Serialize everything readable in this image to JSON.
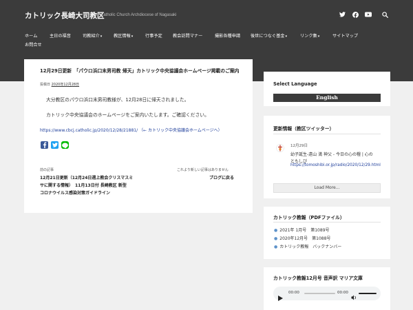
{
  "header": {
    "site_title": "カトリック長崎大司教区",
    "site_subtitle": "Catholic Church Archdiocese of Nagasaki",
    "social": [
      "twitter-icon",
      "facebook-icon",
      "youtube-icon",
      "search-icon"
    ]
  },
  "nav": [
    {
      "label": "ホーム"
    },
    {
      "label": "主日の福音"
    },
    {
      "label": "司教紹介",
      "caret": "▾"
    },
    {
      "label": "教区情報",
      "caret": "▾"
    },
    {
      "label": "行事予定"
    },
    {
      "label": "教会訪問マナー"
    },
    {
      "label": "撮影各種申請"
    },
    {
      "label": "後世につなぐ基金",
      "caret": "▾"
    },
    {
      "label": "リンク集",
      "caret": "▾"
    },
    {
      "label": "サイトマップ"
    },
    {
      "label": "お問合せ"
    }
  ],
  "post": {
    "title": "12月29日更新　「パウロ浜口末男司教 帰天」カトリック中央協議会ホームページ掲載のご案内",
    "meta_prefix": "投稿日",
    "meta_date": "2020年12月28日",
    "para1": "大分教区のパウロ浜口末男司教様が、12月28日に帰天されました。",
    "para2": "カトリック中央協議会のホームページをご案内いたします。ご確認ください。",
    "link_url": "https://www.cbcj.catholic.jp/2020/12/28/21881/",
    "link_note": "（← カトリック中央協議会ホームページへ）",
    "prev_label": "前の記事",
    "prev_title_lines": [
      "12月21日更新（12月24日週上教会クリスマスミ",
      "サに関する情報）　11月13日付 長崎教区 新型",
      "コロナウイルス感染対策ガイドライン"
    ],
    "next_label": "これより新しい記事はありません",
    "next_title": "ブログに戻る"
  },
  "sidebar": {
    "lang_title": "Select Language",
    "lang_value": "English",
    "tweets_title": "更新情報（教区ツイッター）",
    "tweet_date": "12月29日",
    "tweet_text_lines": [
      "幼子誕生-遠山 満 神父 - 今日の心の糧 | 心の",
      "ともしび"
    ],
    "tweet_link": "https://tomoshibi.or.jp/radio/2020/12/29.html",
    "load_more": "Load More...",
    "pdf_title": "カトリック教報（PDFファイル）",
    "pdf_items": [
      "2021年 1月号　第1089号",
      "2020年12月号　第1088号",
      "カトリック教報　バックナンバー"
    ],
    "audio_title": "カトリック教報12月号 音声訳 マリア文庫",
    "audio_time": "00:00",
    "audio_duration": "00:00"
  },
  "colors": {
    "header_bg": "#3b3b3b",
    "link": "#1d3d9a",
    "facebook": "#3b5998",
    "twitter": "#1da1f2",
    "line": "#00b900"
  }
}
